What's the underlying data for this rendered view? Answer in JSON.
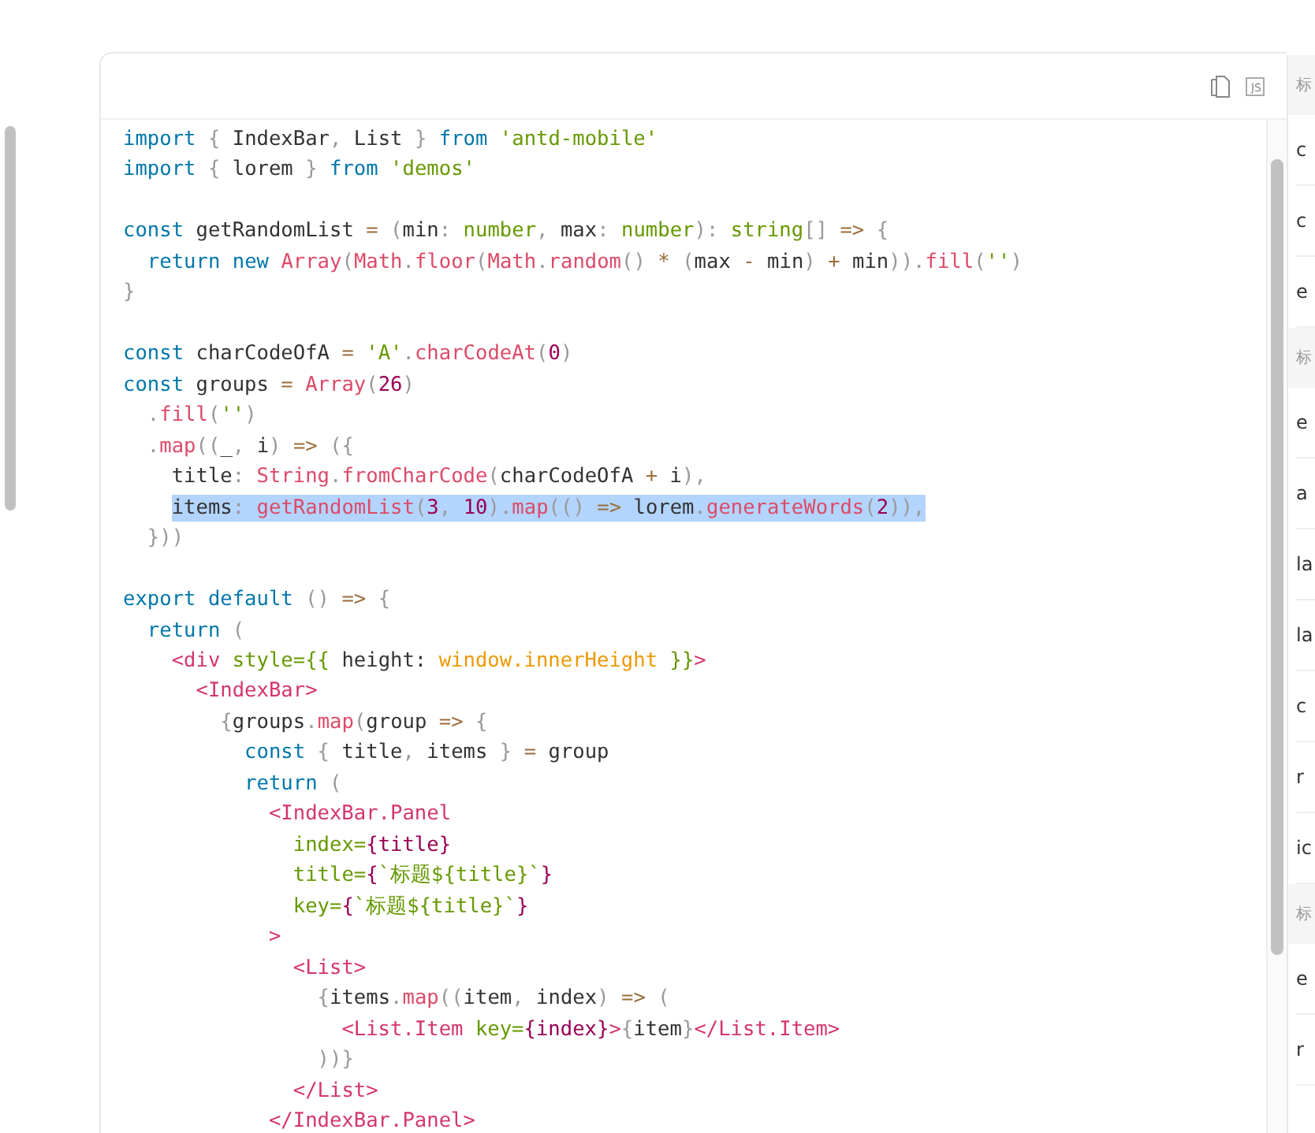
{
  "code_card": {
    "toolbar": {
      "lang_badge": "JS"
    },
    "lines": [
      {
        "kind": "code",
        "selected": false,
        "tokens": [
          {
            "kind": "kw",
            "text": "import"
          },
          {
            "kind": "p",
            "text": " { "
          },
          {
            "kind": "t",
            "text": "IndexBar"
          },
          {
            "kind": "p",
            "text": ", "
          },
          {
            "kind": "t",
            "text": "List"
          },
          {
            "kind": "p",
            "text": " } "
          },
          {
            "kind": "kw",
            "text": "from"
          },
          {
            "kind": "s",
            "text": " 'antd-mobile'"
          }
        ]
      },
      {
        "kind": "code",
        "selected": false,
        "tokens": [
          {
            "kind": "kw",
            "text": "import"
          },
          {
            "kind": "p",
            "text": " { "
          },
          {
            "kind": "t",
            "text": "lorem"
          },
          {
            "kind": "p",
            "text": " } "
          },
          {
            "kind": "kw",
            "text": "from"
          },
          {
            "kind": "s",
            "text": " 'demos'"
          }
        ]
      },
      {
        "kind": "blank"
      },
      {
        "kind": "code",
        "selected": false,
        "tokens": [
          {
            "kind": "kw",
            "text": "const"
          },
          {
            "kind": "t",
            "text": " getRandomList "
          },
          {
            "kind": "o",
            "text": "="
          },
          {
            "kind": "p",
            "text": " ("
          },
          {
            "kind": "t",
            "text": "min"
          },
          {
            "kind": "p",
            "text": ":"
          },
          {
            "kind": "s",
            "text": " number"
          },
          {
            "kind": "p",
            "text": ", "
          },
          {
            "kind": "t",
            "text": "max"
          },
          {
            "kind": "p",
            "text": ":"
          },
          {
            "kind": "s",
            "text": " number"
          },
          {
            "kind": "p",
            "text": "):"
          },
          {
            "kind": "s",
            "text": " string"
          },
          {
            "kind": "p",
            "text": "[]"
          },
          {
            "kind": "o",
            "text": " =>"
          },
          {
            "kind": "p",
            "text": " {"
          }
        ]
      },
      {
        "kind": "code",
        "selected": false,
        "tokens": [
          {
            "kind": "kw",
            "text": "  return"
          },
          {
            "kind": "kw",
            "text": " new"
          },
          {
            "kind": "f",
            "text": " Array"
          },
          {
            "kind": "p",
            "text": "("
          },
          {
            "kind": "f",
            "text": "Math"
          },
          {
            "kind": "p",
            "text": "."
          },
          {
            "kind": "f",
            "text": "floor"
          },
          {
            "kind": "p",
            "text": "("
          },
          {
            "kind": "f",
            "text": "Math"
          },
          {
            "kind": "p",
            "text": "."
          },
          {
            "kind": "f",
            "text": "random"
          },
          {
            "kind": "p",
            "text": "()"
          },
          {
            "kind": "o",
            "text": " *"
          },
          {
            "kind": "p",
            "text": " ("
          },
          {
            "kind": "t",
            "text": "max "
          },
          {
            "kind": "o",
            "text": "-"
          },
          {
            "kind": "t",
            "text": " min"
          },
          {
            "kind": "p",
            "text": ")"
          },
          {
            "kind": "o",
            "text": " +"
          },
          {
            "kind": "t",
            "text": " min"
          },
          {
            "kind": "p",
            "text": "))."
          },
          {
            "kind": "f",
            "text": "fill"
          },
          {
            "kind": "p",
            "text": "("
          },
          {
            "kind": "s",
            "text": "''"
          },
          {
            "kind": "p",
            "text": ")"
          }
        ]
      },
      {
        "kind": "code",
        "selected": false,
        "tokens": [
          {
            "kind": "p",
            "text": "}"
          }
        ]
      },
      {
        "kind": "blank"
      },
      {
        "kind": "code",
        "selected": false,
        "tokens": [
          {
            "kind": "kw",
            "text": "const"
          },
          {
            "kind": "t",
            "text": " charCodeOfA "
          },
          {
            "kind": "o",
            "text": "="
          },
          {
            "kind": "s",
            "text": " 'A'"
          },
          {
            "kind": "p",
            "text": "."
          },
          {
            "kind": "f",
            "text": "charCodeAt"
          },
          {
            "kind": "p",
            "text": "("
          },
          {
            "kind": "n",
            "text": "0"
          },
          {
            "kind": "p",
            "text": ")"
          }
        ]
      },
      {
        "kind": "code",
        "selected": false,
        "tokens": [
          {
            "kind": "kw",
            "text": "const"
          },
          {
            "kind": "t",
            "text": " groups "
          },
          {
            "kind": "o",
            "text": "="
          },
          {
            "kind": "f",
            "text": " Array"
          },
          {
            "kind": "p",
            "text": "("
          },
          {
            "kind": "n",
            "text": "26"
          },
          {
            "kind": "p",
            "text": ")"
          }
        ]
      },
      {
        "kind": "code",
        "selected": false,
        "tokens": [
          {
            "kind": "p",
            "text": "  ."
          },
          {
            "kind": "f",
            "text": "fill"
          },
          {
            "kind": "p",
            "text": "("
          },
          {
            "kind": "s",
            "text": "''"
          },
          {
            "kind": "p",
            "text": ")"
          }
        ]
      },
      {
        "kind": "code",
        "selected": false,
        "tokens": [
          {
            "kind": "p",
            "text": "  ."
          },
          {
            "kind": "f",
            "text": "map"
          },
          {
            "kind": "p",
            "text": "(("
          },
          {
            "kind": "t",
            "text": "_"
          },
          {
            "kind": "p",
            "text": ","
          },
          {
            "kind": "t",
            "text": " i"
          },
          {
            "kind": "p",
            "text": ")"
          },
          {
            "kind": "o",
            "text": " =>"
          },
          {
            "kind": "p",
            "text": " ({"
          }
        ]
      },
      {
        "kind": "code",
        "selected": false,
        "tokens": [
          {
            "kind": "t",
            "text": "    title"
          },
          {
            "kind": "p",
            "text": ":"
          },
          {
            "kind": "f",
            "text": " String"
          },
          {
            "kind": "p",
            "text": "."
          },
          {
            "kind": "f",
            "text": "fromCharCode"
          },
          {
            "kind": "p",
            "text": "("
          },
          {
            "kind": "t",
            "text": "charCodeOfA "
          },
          {
            "kind": "o",
            "text": "+"
          },
          {
            "kind": "t",
            "text": " i"
          },
          {
            "kind": "p",
            "text": "),"
          }
        ]
      },
      {
        "kind": "code",
        "selected": true,
        "tokens": [
          {
            "kind": "t",
            "text": "    items"
          },
          {
            "kind": "p",
            "text": ":"
          },
          {
            "kind": "f",
            "text": " getRandomList"
          },
          {
            "kind": "p",
            "text": "("
          },
          {
            "kind": "n",
            "text": "3"
          },
          {
            "kind": "p",
            "text": ", "
          },
          {
            "kind": "n",
            "text": "10"
          },
          {
            "kind": "p",
            "text": ")."
          },
          {
            "kind": "f",
            "text": "map"
          },
          {
            "kind": "p",
            "text": "(()"
          },
          {
            "kind": "o",
            "text": " =>"
          },
          {
            "kind": "t",
            "text": " lorem"
          },
          {
            "kind": "p",
            "text": "."
          },
          {
            "kind": "f",
            "text": "generateWords"
          },
          {
            "kind": "p",
            "text": "("
          },
          {
            "kind": "n",
            "text": "2"
          },
          {
            "kind": "p",
            "text": ")),"
          }
        ]
      },
      {
        "kind": "code",
        "selected": false,
        "tokens": [
          {
            "kind": "p",
            "text": "  }))"
          }
        ]
      },
      {
        "kind": "blank"
      },
      {
        "kind": "code",
        "selected": false,
        "tokens": [
          {
            "kind": "kw",
            "text": "export"
          },
          {
            "kind": "kw",
            "text": " default"
          },
          {
            "kind": "p",
            "text": " ()"
          },
          {
            "kind": "o",
            "text": " =>"
          },
          {
            "kind": "p",
            "text": " {"
          }
        ]
      },
      {
        "kind": "code",
        "selected": false,
        "tokens": [
          {
            "kind": "kw",
            "text": "  return"
          },
          {
            "kind": "p",
            "text": " ("
          }
        ]
      },
      {
        "kind": "code",
        "selected": false,
        "tokens": [
          {
            "kind": "tag",
            "text": "    <div"
          },
          {
            "kind": "a",
            "text": " style={{"
          },
          {
            "kind": "t",
            "text": " height: "
          },
          {
            "kind": "v",
            "text": "window.innerHeight"
          },
          {
            "kind": "a",
            "text": " }}"
          },
          {
            "kind": "tag",
            "text": ">"
          }
        ]
      },
      {
        "kind": "code",
        "selected": false,
        "tokens": [
          {
            "kind": "tag",
            "text": "      <IndexBar>"
          }
        ]
      },
      {
        "kind": "code",
        "selected": false,
        "tokens": [
          {
            "kind": "p",
            "text": "        {"
          },
          {
            "kind": "t",
            "text": "groups"
          },
          {
            "kind": "p",
            "text": "."
          },
          {
            "kind": "f",
            "text": "map"
          },
          {
            "kind": "p",
            "text": "("
          },
          {
            "kind": "t",
            "text": "group "
          },
          {
            "kind": "o",
            "text": "=>"
          },
          {
            "kind": "p",
            "text": " {"
          }
        ]
      },
      {
        "kind": "code",
        "selected": false,
        "tokens": [
          {
            "kind": "kw",
            "text": "          const"
          },
          {
            "kind": "p",
            "text": " {"
          },
          {
            "kind": "t",
            "text": " title"
          },
          {
            "kind": "p",
            "text": ","
          },
          {
            "kind": "t",
            "text": " items "
          },
          {
            "kind": "p",
            "text": "}"
          },
          {
            "kind": "o",
            "text": " ="
          },
          {
            "kind": "t",
            "text": " group"
          }
        ]
      },
      {
        "kind": "code",
        "selected": false,
        "tokens": [
          {
            "kind": "kw",
            "text": "          return"
          },
          {
            "kind": "p",
            "text": " ("
          }
        ]
      },
      {
        "kind": "code",
        "selected": false,
        "tokens": [
          {
            "kind": "tag",
            "text": "            <IndexBar.Panel"
          }
        ]
      },
      {
        "kind": "code",
        "selected": false,
        "tokens": [
          {
            "kind": "a",
            "text": "              index="
          },
          {
            "kind": "n",
            "text": "{title}"
          }
        ]
      },
      {
        "kind": "code",
        "selected": false,
        "tokens": [
          {
            "kind": "a",
            "text": "              title="
          },
          {
            "kind": "n",
            "text": "{"
          },
          {
            "kind": "a",
            "text": "`标题${title}`"
          },
          {
            "kind": "n",
            "text": "}"
          }
        ]
      },
      {
        "kind": "code",
        "selected": false,
        "tokens": [
          {
            "kind": "a",
            "text": "              key="
          },
          {
            "kind": "n",
            "text": "{"
          },
          {
            "kind": "a",
            "text": "`标题${title}`"
          },
          {
            "kind": "n",
            "text": "}"
          }
        ]
      },
      {
        "kind": "code",
        "selected": false,
        "tokens": [
          {
            "kind": "tag",
            "text": "            >"
          }
        ]
      },
      {
        "kind": "code",
        "selected": false,
        "tokens": [
          {
            "kind": "tag",
            "text": "              <List>"
          }
        ]
      },
      {
        "kind": "code",
        "selected": false,
        "tokens": [
          {
            "kind": "p",
            "text": "                {"
          },
          {
            "kind": "t",
            "text": "items"
          },
          {
            "kind": "p",
            "text": "."
          },
          {
            "kind": "f",
            "text": "map"
          },
          {
            "kind": "p",
            "text": "(("
          },
          {
            "kind": "t",
            "text": "item"
          },
          {
            "kind": "p",
            "text": ","
          },
          {
            "kind": "t",
            "text": " index"
          },
          {
            "kind": "p",
            "text": ")"
          },
          {
            "kind": "o",
            "text": " =>"
          },
          {
            "kind": "p",
            "text": " ("
          }
        ]
      },
      {
        "kind": "code",
        "selected": false,
        "tokens": [
          {
            "kind": "tag",
            "text": "                  <List.Item"
          },
          {
            "kind": "a",
            "text": " key="
          },
          {
            "kind": "n",
            "text": "{index}"
          },
          {
            "kind": "tag",
            "text": ">"
          },
          {
            "kind": "p",
            "text": "{"
          },
          {
            "kind": "t",
            "text": "item"
          },
          {
            "kind": "p",
            "text": "}"
          },
          {
            "kind": "tag",
            "text": "</List.Item>"
          }
        ]
      },
      {
        "kind": "code",
        "selected": false,
        "tokens": [
          {
            "kind": "p",
            "text": "                ))}"
          }
        ]
      },
      {
        "kind": "code",
        "selected": false,
        "tokens": [
          {
            "kind": "tag",
            "text": "              </List>"
          }
        ]
      },
      {
        "kind": "code",
        "selected": false,
        "tokens": [
          {
            "kind": "tag",
            "text": "            </IndexBar.Panel>"
          }
        ]
      }
    ]
  },
  "preview": {
    "items": [
      {
        "kind": "header",
        "text": "标"
      },
      {
        "kind": "item",
        "text": "c"
      },
      {
        "kind": "item",
        "text": "c"
      },
      {
        "kind": "item",
        "text": "e"
      },
      {
        "kind": "header",
        "text": "标"
      },
      {
        "kind": "item",
        "text": "e"
      },
      {
        "kind": "item",
        "text": "a"
      },
      {
        "kind": "item",
        "text": "la"
      },
      {
        "kind": "item",
        "text": "la"
      },
      {
        "kind": "item",
        "text": "c"
      },
      {
        "kind": "item",
        "text": "r"
      },
      {
        "kind": "item",
        "text": "ic"
      },
      {
        "kind": "header",
        "text": "标"
      },
      {
        "kind": "item",
        "text": "e"
      },
      {
        "kind": "item",
        "text": "r"
      }
    ]
  }
}
